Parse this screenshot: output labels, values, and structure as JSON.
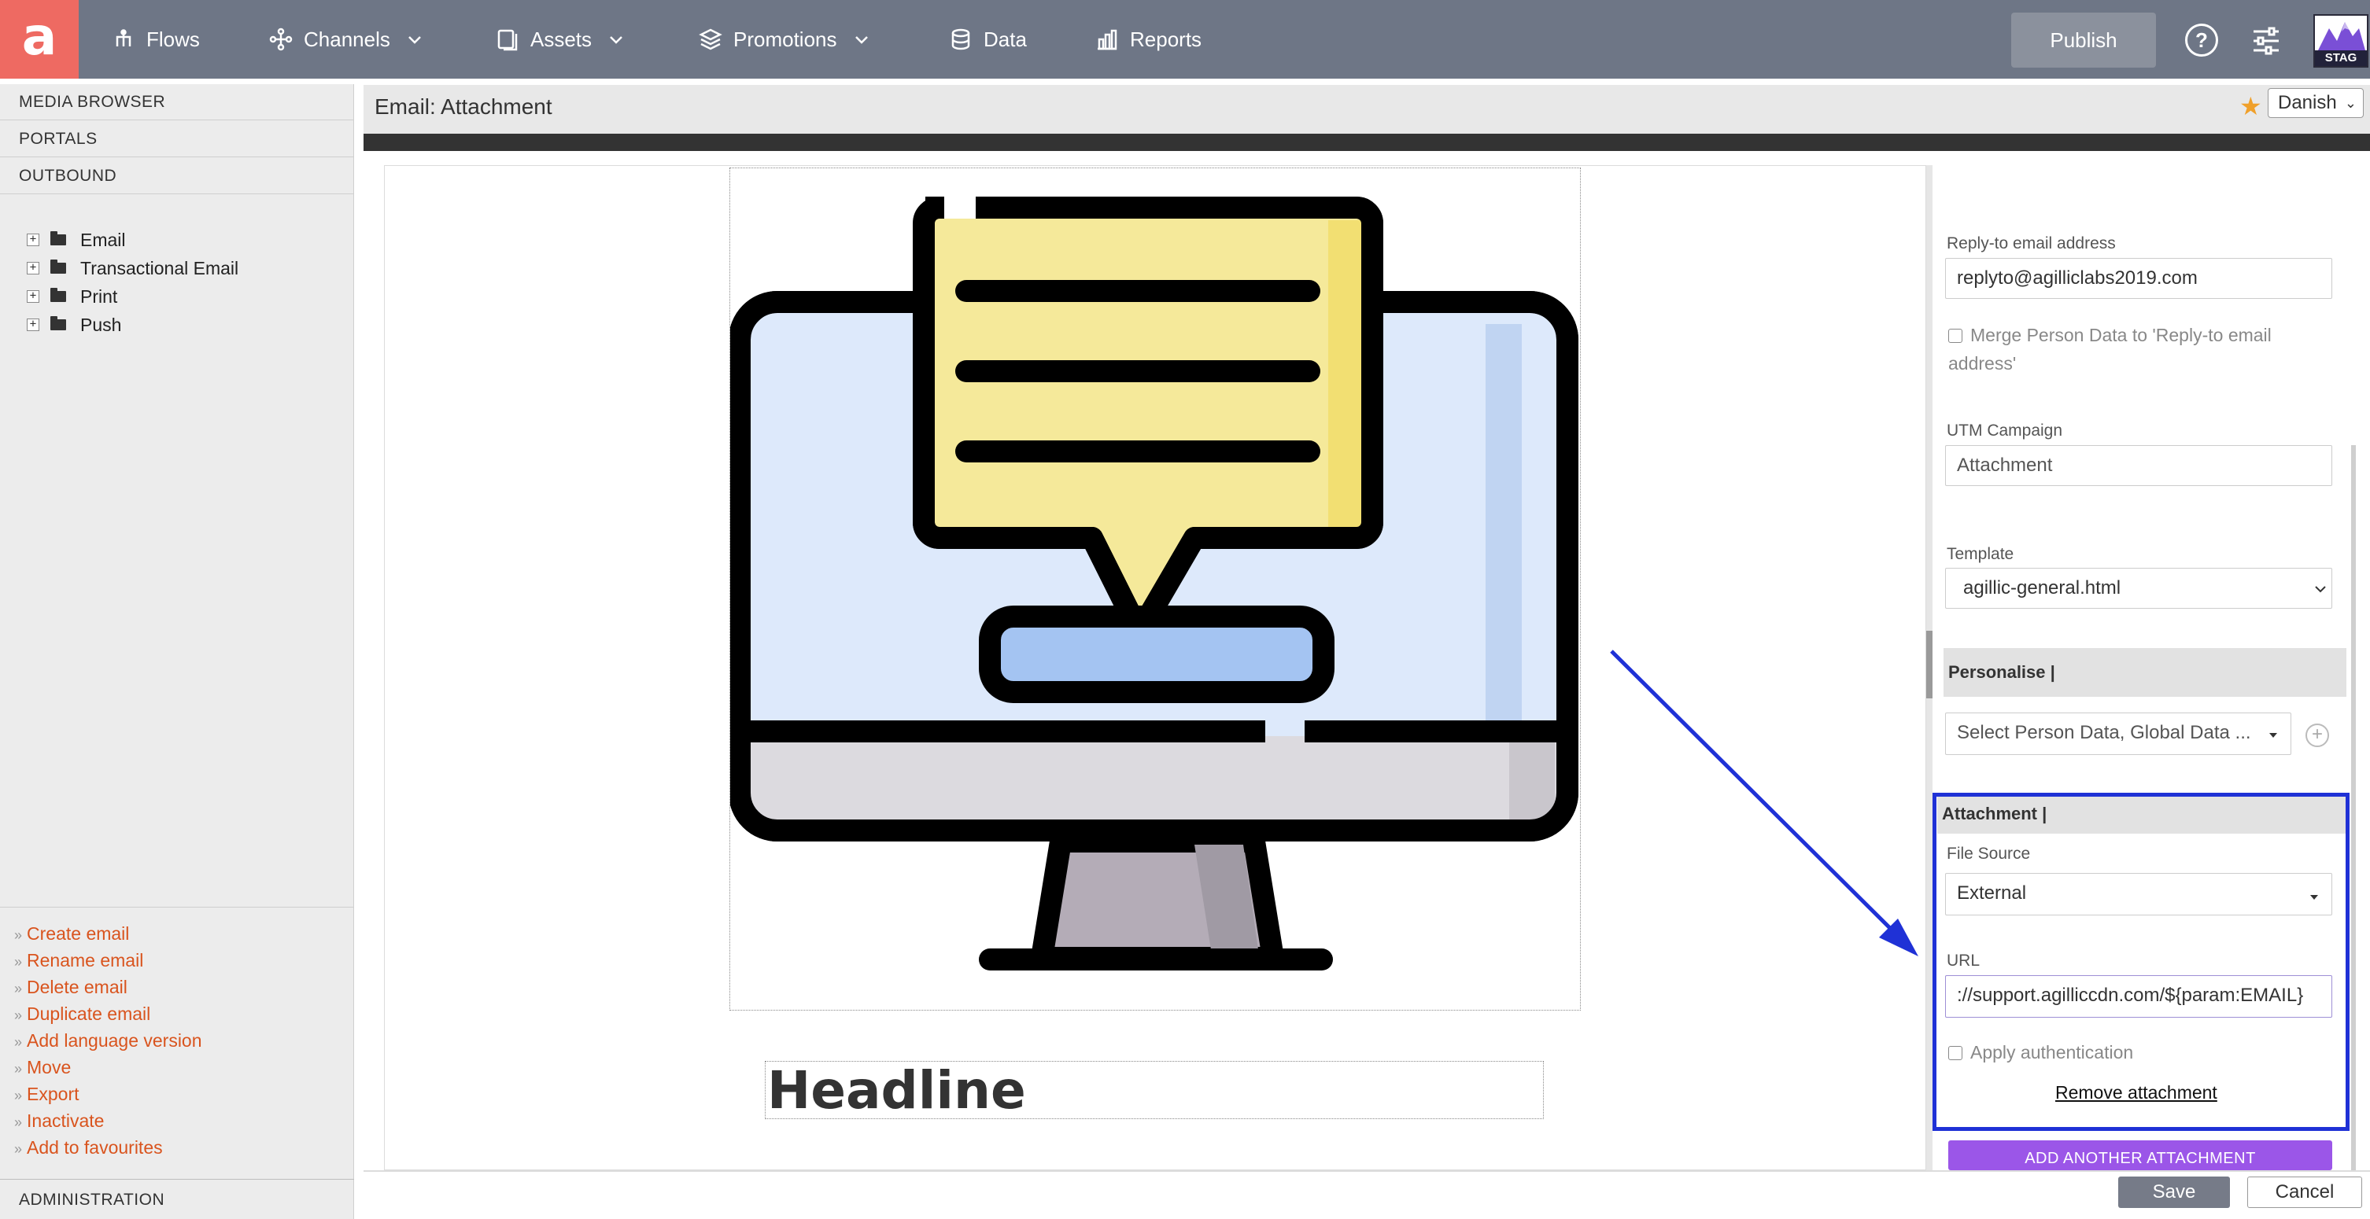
{
  "nav": {
    "logo": "a",
    "items": [
      {
        "label": "Flows",
        "icon": "flows-icon"
      },
      {
        "label": "Channels",
        "icon": "channels-icon"
      },
      {
        "label": "Assets",
        "icon": "assets-icon"
      },
      {
        "label": "Promotions",
        "icon": "promotions-icon"
      },
      {
        "label": "Data",
        "icon": "database-icon"
      },
      {
        "label": "Reports",
        "icon": "bar-chart-icon"
      }
    ],
    "publish_label": "Publish",
    "help_label": "?",
    "env_badge": "STAG"
  },
  "sidebar": {
    "sections": [
      "MEDIA BROWSER",
      "PORTALS",
      "OUTBOUND"
    ],
    "tree": [
      {
        "label": "Email",
        "expander": "+"
      },
      {
        "label": "Transactional Email",
        "expander": "+"
      },
      {
        "label": "Print",
        "expander": "+"
      },
      {
        "label": "Push",
        "expander": "+"
      }
    ],
    "action_prefix": "»",
    "actions": [
      "Create email",
      "Rename email",
      "Delete email",
      "Duplicate email",
      "Add language version",
      "Move",
      "Export",
      "Inactivate",
      "Add to favourites"
    ],
    "admin_label": "ADMINISTRATION"
  },
  "main": {
    "title": "Email: Attachment",
    "star": "★",
    "language": "Danish",
    "headline": "Headline"
  },
  "panel": {
    "reply_to_label": "Reply-to email address",
    "reply_to_value": "replyto@agilliclabs2019.com",
    "merge_label": "Merge Person Data to 'Reply-to email address'",
    "utm_label": "UTM Campaign",
    "utm_value": "Attachment",
    "template_label": "Template",
    "template_value": "agillic-general.html",
    "personalise_label": "Personalise |",
    "personalise_placeholder": "Select Person Data, Global Data ...",
    "attachment_label": "Attachment |",
    "file_source_label": "File Source",
    "file_source_value": "External",
    "url_label": "URL",
    "url_value": "://support.agilliccdn.com/${param:EMAIL}",
    "auth_label": "Apply authentication",
    "remove_label": "Remove attachment",
    "add_another_label": "ADD ANOTHER ATTACHMENT"
  },
  "footer": {
    "save_label": "Save",
    "cancel_label": "Cancel"
  },
  "colors": {
    "topbar": "#6e7686",
    "logo": "#ee6a62",
    "action_link": "#d9541e",
    "highlight": "#1f31d6",
    "add_button": "#9b56e8"
  }
}
